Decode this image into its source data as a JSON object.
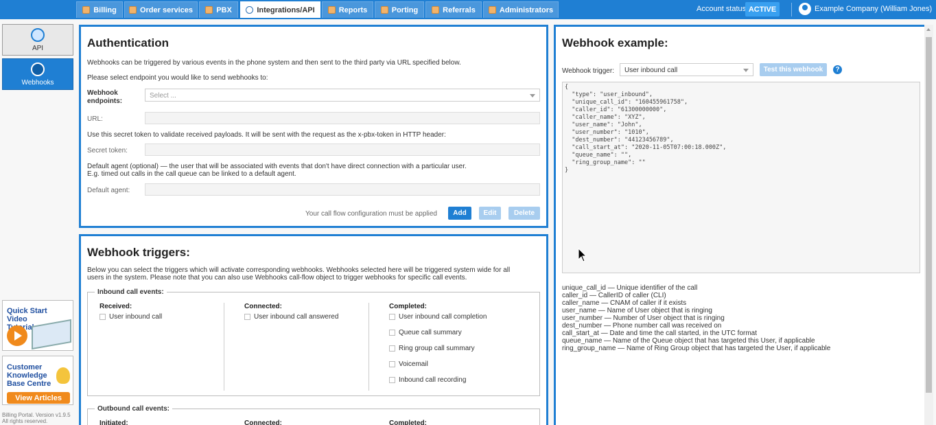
{
  "tabs": [
    {
      "label": "Billing",
      "icon": "billing-icon"
    },
    {
      "label": "Order services",
      "icon": "cart-icon"
    },
    {
      "label": "PBX",
      "icon": "pbx-icon"
    },
    {
      "label": "Integrations/API",
      "icon": "integrations-icon",
      "active": true
    },
    {
      "label": "Reports",
      "icon": "reports-icon"
    },
    {
      "label": "Porting",
      "icon": "porting-icon"
    },
    {
      "label": "Referrals",
      "icon": "referrals-icon"
    },
    {
      "label": "Administrators",
      "icon": "administrators-icon"
    }
  ],
  "account": {
    "status_label": "Account status:",
    "status": "ACTIVE",
    "user": "Example Company (William Jones)"
  },
  "sidebar": {
    "items": [
      {
        "label": "API"
      },
      {
        "label": "Webhooks"
      }
    ],
    "promo_video": {
      "title": "Quick Start Video Tutorial"
    },
    "promo_kb": {
      "title": "Customer Knowledge Base Centre",
      "button": "View Articles"
    },
    "footer": "Billing Portal. Version v1.9.5",
    "footer2": "All rights reserved."
  },
  "auth": {
    "title": "Authentication",
    "intro": "Webhooks can be triggered by various events in the phone system and then sent to the third party via URL specified below.",
    "select_prompt": "Please select endpoint you would like to send webhooks to:",
    "endpoints_label": "Webhook endpoints:",
    "endpoints_placeholder": "Select ...",
    "url_label": "URL:",
    "token_help": "Use this secret token to validate received payloads. It will be sent with the request as the x-pbx-token in HTTP header:",
    "token_label": "Secret token:",
    "agent_help1": "Default agent (optional) — the user that will be associated with events that don't have direct connection with a particular user.",
    "agent_help2": "E.g. timed out calls in the call queue can be linked to a default agent.",
    "agent_label": "Default agent:",
    "notice": "Your call flow configuration must be applied",
    "add": "Add",
    "edit": "Edit",
    "delete": "Delete"
  },
  "triggers": {
    "title": "Webhook triggers:",
    "intro1": "Below you can select the triggers which will activate corresponding webhooks. Webhooks selected here will be triggered system wide for all",
    "intro2": "users in the system. Please note that you can also use Webhooks call-flow object to trigger webhooks for specific call events.",
    "inbound": {
      "legend": "Inbound call events:",
      "received_head": "Received:",
      "received": [
        "User inbound call"
      ],
      "connected_head": "Connected:",
      "connected": [
        "User inbound call answered"
      ],
      "completed_head": "Completed:",
      "completed": [
        "User inbound call completion",
        "Queue call summary",
        "Ring group call summary",
        "Voicemail",
        "Inbound call recording"
      ]
    },
    "outbound": {
      "legend": "Outbound call events:",
      "initiated_head": "Initiated:",
      "connected_head": "Connected:",
      "completed_head": "Completed:"
    }
  },
  "example": {
    "title": "Webhook example:",
    "trigger_label": "Webhook trigger:",
    "trigger_value": "User inbound call",
    "test_button": "Test this webhook",
    "code": "{\n  \"type\": \"user_inbound\",\n  \"unique_call_id\": \"160455961758\",\n  \"caller_id\": \"61300000000\",\n  \"caller_name\": \"XYZ\",\n  \"user_name\": \"John\",\n  \"user_number\": \"1010\",\n  \"dest_number\": \"44123456789\",\n  \"call_start_at\": \"2020-11-05T07:00:18.000Z\",\n  \"queue_name\": \"\",\n  \"ring_group_name\": \"\"\n}",
    "descriptions": [
      "unique_call_id — Unique identifier of the call",
      "caller_id — CallerID of caller (CLI)",
      "caller_name — CNAM of caller if it exists",
      "user_name — Name of User object that is ringing",
      "user_number — Number of User object that is ringing",
      "dest_number — Phone number call was received on",
      "call_start_at — Date and time the call started, in the UTC format",
      "queue_name — Name of the Queue object that has targeted this User, if applicable",
      "ring_group_name — Name of Ring Group object that has targeted the User, if applicable"
    ]
  }
}
